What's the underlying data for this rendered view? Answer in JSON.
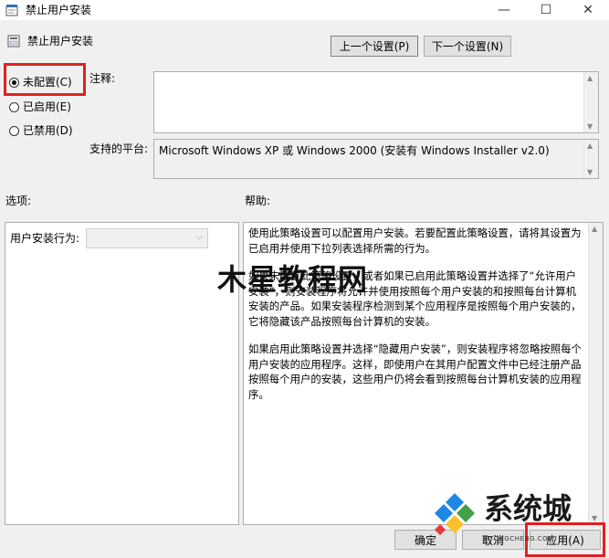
{
  "window": {
    "title": "禁止用户安装",
    "minimize_glyph": "—",
    "maximize_glyph": "☐",
    "close_glyph": "✕"
  },
  "header": {
    "title": "禁止用户安装",
    "prev_setting": "上一个设置(P)",
    "next_setting": "下一个设置(N)"
  },
  "state": {
    "not_configured": "未配置(C)",
    "enabled": "已启用(E)",
    "disabled": "已禁用(D)",
    "selected": "not_configured"
  },
  "comment": {
    "label": "注释:",
    "value": ""
  },
  "platform": {
    "label": "支持的平台:",
    "value": "Microsoft Windows XP 或 Windows 2000 (安装有 Windows Installer v2.0)"
  },
  "options": {
    "label": "选项:",
    "install_behavior_label": "用户安装行为:",
    "install_behavior_value": ""
  },
  "help": {
    "label": "帮助:",
    "paragraphs": [
      "使用此策略设置可以配置用户安装。若要配置此策略设置，请将其设置为已启用并使用下拉列表选择所需的行为。",
      "如果未配置此策略设置，或者如果已启用此策略设置并选择了“允许用户安装”，则安装程序将允许并使用按照每个用户安装的和按照每台计算机安装的产品。如果安装程序检测到某个应用程序是按照每个用户安装的，它将隐藏该产品按照每台计算机的安装。",
      "如果启用此策略设置并选择“隐藏用户安装”，则安装程序将忽略按照每个用户安装的应用程序。这样，即使用户在其用户配置文件中已经注册产品按照每个用户的安装，这些用户仍将会看到按照每台计算机安装的应用程序。"
    ]
  },
  "footer": {
    "ok": "确定",
    "cancel": "取消",
    "apply": "应用(A)"
  },
  "watermarks": {
    "center": "木星教程网",
    "brand": "系统城",
    "brand_small": "XITONGCHENG.COM"
  },
  "colors": {
    "highlight": "#e02020",
    "logo_blue": "#1e88e5",
    "logo_green": "#43a047",
    "logo_yellow": "#fbc02d",
    "logo_red": "#e53935"
  }
}
